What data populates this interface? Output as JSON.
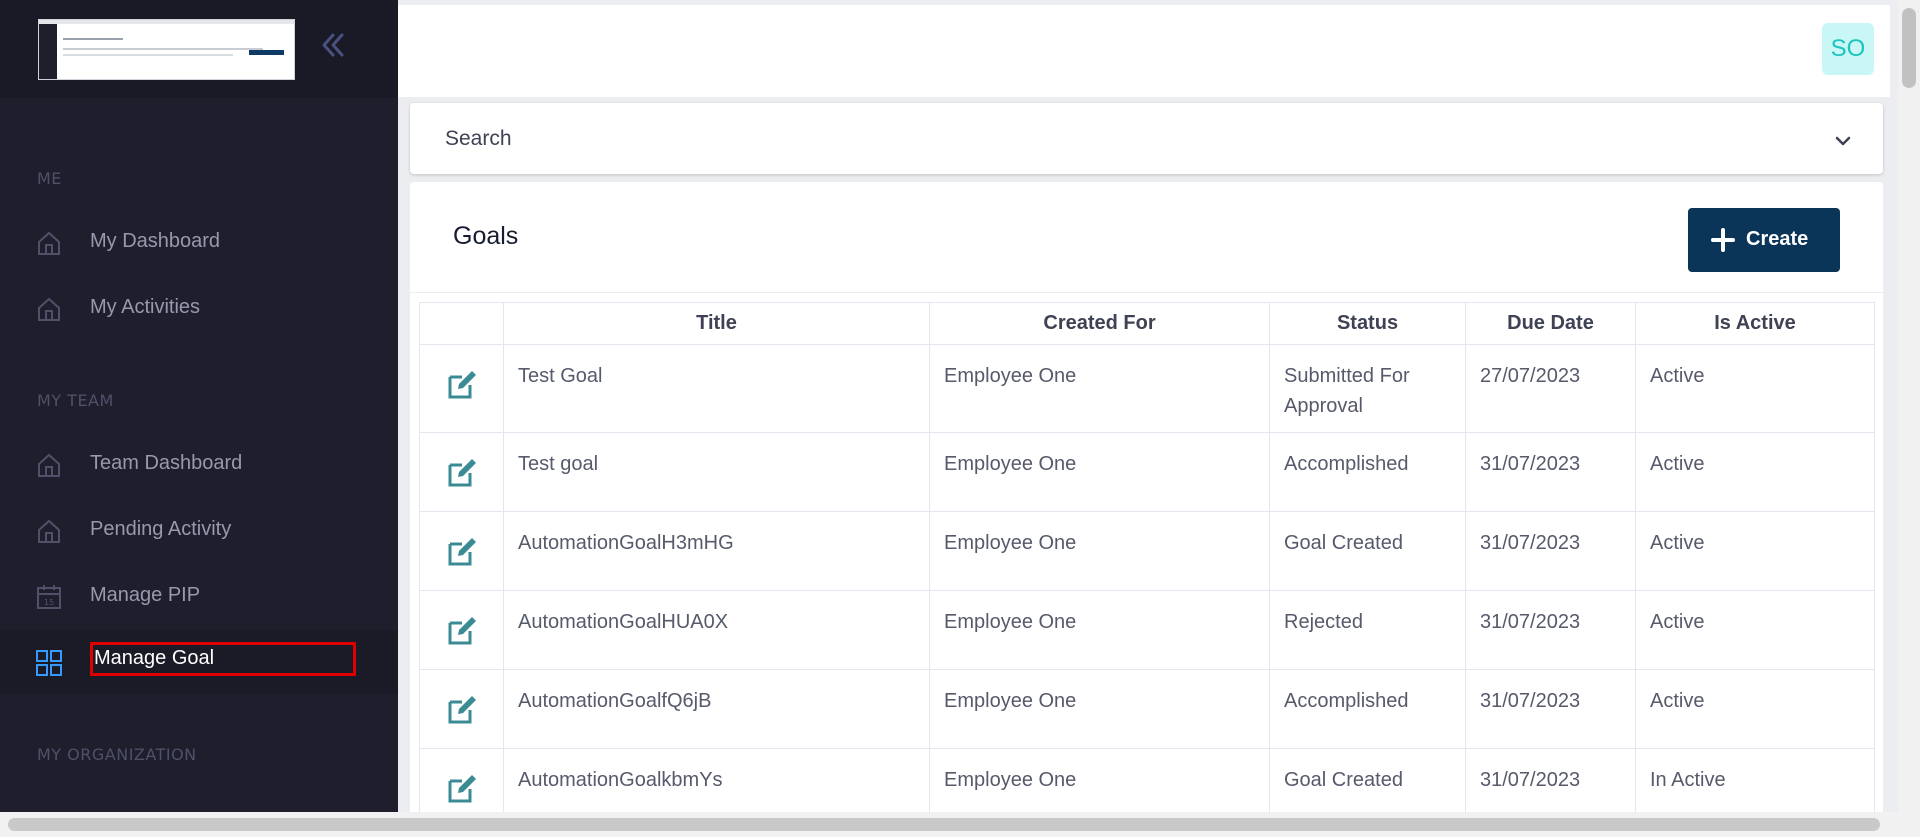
{
  "sidebar": {
    "sections": {
      "me": "ME",
      "my_team": "MY TEAM",
      "my_organization": "MY ORGANIZATION"
    },
    "items": [
      {
        "label": "My Dashboard",
        "icon": "home-icon"
      },
      {
        "label": "My Activities",
        "icon": "home-icon"
      },
      {
        "label": "Team Dashboard",
        "icon": "home-icon"
      },
      {
        "label": "Pending Activity",
        "icon": "home-icon"
      },
      {
        "label": "Manage PIP",
        "icon": "calendar-icon"
      },
      {
        "label": "Manage Goal",
        "icon": "grid-icon",
        "active": true
      }
    ]
  },
  "header": {
    "avatar_initials": "SO"
  },
  "search": {
    "label": "Search"
  },
  "goals": {
    "title": "Goals",
    "create_label": "Create",
    "columns": [
      "Title",
      "Created For",
      "Status",
      "Due Date",
      "Is Active"
    ],
    "rows": [
      {
        "title": "Test Goal",
        "created_for": "Employee One",
        "status": "Submitted For Approval",
        "due_date": "27/07/2023",
        "is_active": "Active"
      },
      {
        "title": "Test goal",
        "created_for": "Employee One",
        "status": "Accomplished",
        "due_date": "31/07/2023",
        "is_active": "Active"
      },
      {
        "title": "AutomationGoalH3mHG",
        "created_for": "Employee One",
        "status": "Goal Created",
        "due_date": "31/07/2023",
        "is_active": "Active"
      },
      {
        "title": "AutomationGoalHUA0X",
        "created_for": "Employee One",
        "status": "Rejected",
        "due_date": "31/07/2023",
        "is_active": "Active"
      },
      {
        "title": "AutomationGoalfQ6jB",
        "created_for": "Employee One",
        "status": "Accomplished",
        "due_date": "31/07/2023",
        "is_active": "Active"
      },
      {
        "title": "AutomationGoalkbmYs",
        "created_for": "Employee One",
        "status": "Goal Created",
        "due_date": "31/07/2023",
        "is_active": "In Active"
      }
    ]
  },
  "colors": {
    "sidebar_bg": "#1e1e2d",
    "primary": "#0b3558",
    "edit_icon": "#3b8b95",
    "highlight_border": "#e00000",
    "avatar_bg": "#c9f7f5",
    "avatar_text": "#1bc5bd"
  }
}
